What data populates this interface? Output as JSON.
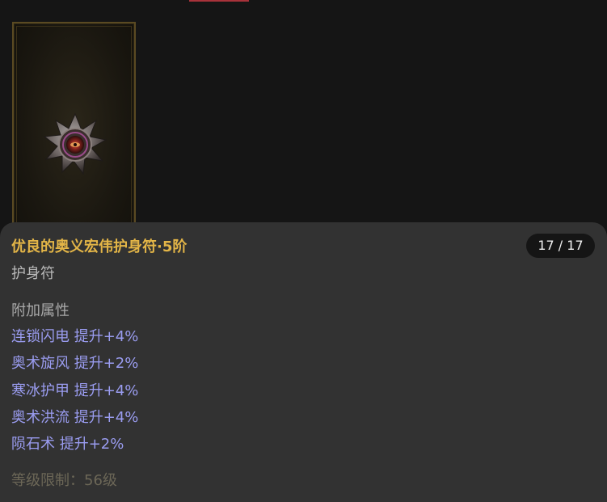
{
  "item": {
    "title": "优良的奥义宏伟护身符·5阶",
    "count": "17 / 17",
    "type": "护身符",
    "attributes_header": "附加属性",
    "attributes": [
      "连锁闪电 提升+4%",
      "奥术旋风 提升+2%",
      "寒冰护甲 提升+4%",
      "奥术洪流 提升+4%",
      "陨石术 提升+2%"
    ],
    "level_requirement": "等级限制：56级",
    "icon": "amulet-icon"
  },
  "colors": {
    "title": "#e3b547",
    "attribute": "#9a9cf0",
    "panel_bg": "#323232",
    "page_bg": "#151515"
  }
}
